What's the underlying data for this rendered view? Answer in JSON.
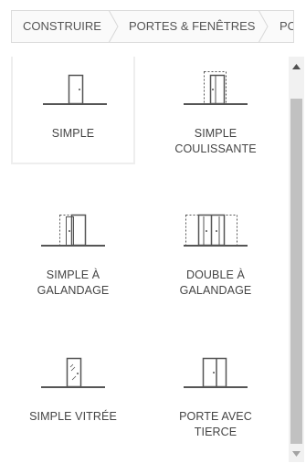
{
  "breadcrumb": {
    "items": [
      {
        "label": "CONSTRUIRE"
      },
      {
        "label": "PORTES & FENÊTRES"
      },
      {
        "label": "PO"
      }
    ]
  },
  "door_types": [
    {
      "label": "SIMPLE",
      "icon": "simple-door-icon",
      "selected": true
    },
    {
      "label": "SIMPLE\nCOULISSANTE",
      "icon": "sliding-door-icon",
      "selected": false
    },
    {
      "label": "SIMPLE À\nGALANDAGE",
      "icon": "pocket-door-icon",
      "selected": false
    },
    {
      "label": "DOUBLE À\nGALANDAGE",
      "icon": "double-pocket-door-icon",
      "selected": false
    },
    {
      "label": "SIMPLE VITRÉE",
      "icon": "glazed-door-icon",
      "selected": false
    },
    {
      "label": "PORTE AVEC\nTIERCE",
      "icon": "door-with-side-panel-icon",
      "selected": false
    }
  ],
  "scrollbar": {
    "up_icon": "scroll-up-arrow-icon",
    "down_icon": "scroll-down-arrow-icon"
  }
}
